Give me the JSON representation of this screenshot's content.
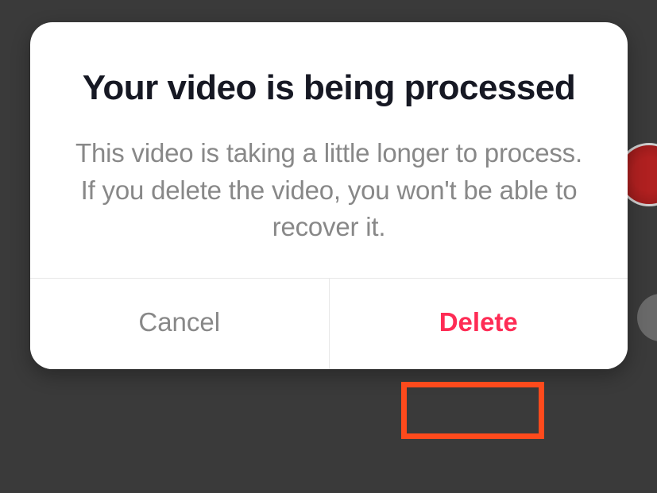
{
  "dialog": {
    "title": "Your video is being processed",
    "message": "This video is taking a little longer to process. If you delete the video, you won't be able to recover it.",
    "cancel_label": "Cancel",
    "delete_label": "Delete"
  }
}
